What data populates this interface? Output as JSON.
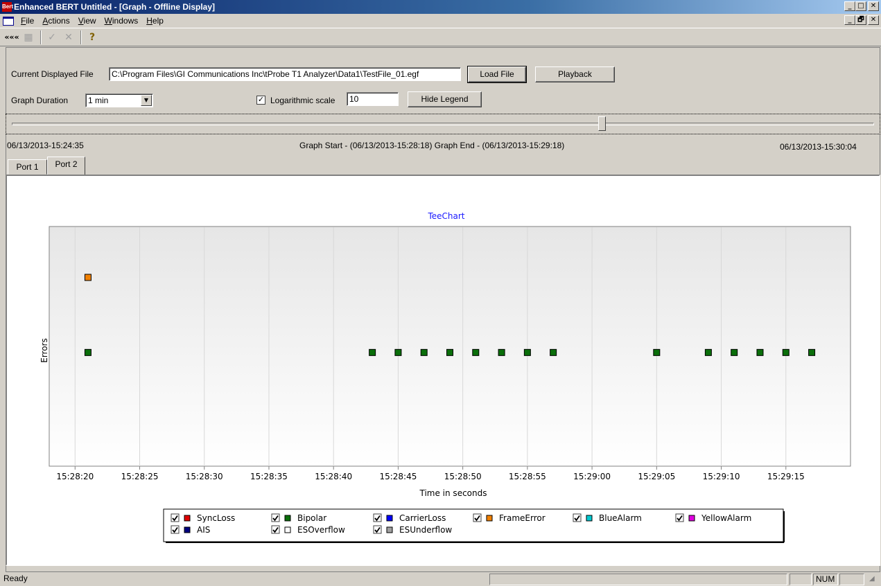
{
  "window": {
    "title": "Enhanced BERT Untitled - [Graph - Offline Display]",
    "app_badge": "Bert",
    "controls": {
      "minimize": "_",
      "maximize": "□",
      "close": "✕",
      "restore": "🗗"
    }
  },
  "menu": {
    "items": [
      {
        "label_u": "F",
        "label_rest": "ile"
      },
      {
        "label_u": "A",
        "label_rest": "ctions"
      },
      {
        "label_u": "V",
        "label_rest": "iew"
      },
      {
        "label_u": "W",
        "label_rest": "indows"
      },
      {
        "label_u": "H",
        "label_rest": "elp"
      }
    ]
  },
  "toolbar": {
    "back_glyph": "«««",
    "grid_glyph": "▦",
    "check_glyph": "✓",
    "cross_glyph": "✕",
    "help_glyph": "?"
  },
  "controls": {
    "file_label": "Current Displayed File",
    "file_path": "C:\\Program Files\\GI Communications Inc\\tProbe T1 Analyzer\\Data1\\TestFile_01.egf",
    "load_button": "Load File",
    "playback_button": "Playback",
    "duration_label": "Graph Duration",
    "duration_value": "1 min",
    "log_checkbox_checked": true,
    "log_label": "Logarithmic scale",
    "log_value": "10",
    "hide_legend_button": "Hide Legend"
  },
  "timeline": {
    "slider_position": 0.685,
    "start": "06/13/2013-15:24:35",
    "range": "Graph Start - (06/13/2013-15:28:18) Graph End - (06/13/2013-15:29:18)",
    "end": "06/13/2013-15:30:04"
  },
  "tabs": [
    {
      "label": "Port 1",
      "active": false
    },
    {
      "label": "Port 2",
      "active": true
    }
  ],
  "statusbar": {
    "text": "Ready",
    "num": "NUM"
  },
  "chart_data": {
    "type": "scatter",
    "title": "TeeChart",
    "xlabel": "Time in seconds",
    "ylabel": "Errors",
    "x_ticks": [
      "15:28:20",
      "15:28:25",
      "15:28:30",
      "15:28:35",
      "15:28:40",
      "15:28:45",
      "15:28:50",
      "15:28:55",
      "15:29:00",
      "15:29:05",
      "15:29:10",
      "15:29:15"
    ],
    "x_range_seconds": [
      -2,
      60
    ],
    "series": [
      {
        "name": "Bipolar",
        "color": "#0a6e0a",
        "x": [
          "15:28:21",
          "15:28:43",
          "15:28:45",
          "15:28:47",
          "15:28:49",
          "15:28:51",
          "15:28:53",
          "15:28:55",
          "15:28:57",
          "15:29:05",
          "15:29:09",
          "15:29:11",
          "15:29:13",
          "15:29:15",
          "15:29:17"
        ],
        "y": [
          1,
          1,
          1,
          1,
          1,
          1,
          1,
          1,
          1,
          1,
          1,
          1,
          1,
          1,
          1
        ]
      },
      {
        "name": "FrameError",
        "color": "#f08000",
        "x": [
          "15:28:21"
        ],
        "y": [
          2
        ]
      }
    ],
    "legend": [
      {
        "name": "SyncLoss",
        "color": "#e00000",
        "checked": true
      },
      {
        "name": "Bipolar",
        "color": "#0a6e0a",
        "checked": true
      },
      {
        "name": "CarrierLoss",
        "color": "#0000ff",
        "checked": true
      },
      {
        "name": "FrameError",
        "color": "#f08000",
        "checked": true
      },
      {
        "name": "BlueAlarm",
        "color": "#00c8d0",
        "checked": true
      },
      {
        "name": "YellowAlarm",
        "color": "#e000e0",
        "checked": true
      },
      {
        "name": "AIS",
        "color": "#00007f",
        "checked": true
      },
      {
        "name": "ESOverflow",
        "color": "#ffffff",
        "checked": true
      },
      {
        "name": "ESUnderflow",
        "color": "#a0a0a0",
        "checked": true
      }
    ],
    "legend_placement": "bottom-center",
    "grid": true
  }
}
